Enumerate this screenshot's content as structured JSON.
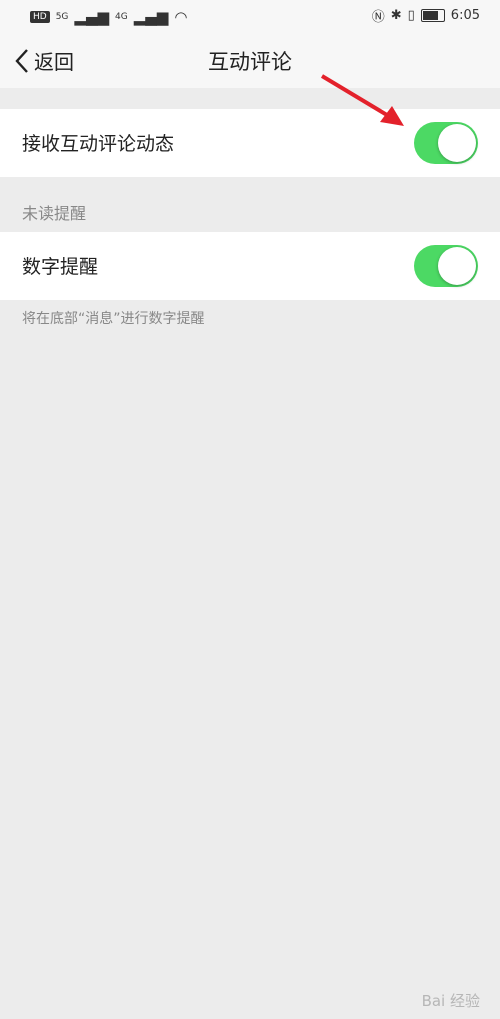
{
  "status_bar": {
    "hd_badge": "HD",
    "net1": "5G",
    "net2": "4G",
    "time": "6:05",
    "battery_level": 0.75
  },
  "nav": {
    "back_label": "返回",
    "title": "互动评论"
  },
  "settings": {
    "receive_comments": {
      "label": "接收互动评论动态",
      "enabled": true
    },
    "unread_section": "未读提醒",
    "number_reminder": {
      "label": "数字提醒",
      "enabled": true
    },
    "note": "将在底部“消息”进行数字提醒"
  },
  "colors": {
    "toggle_on": "#4cd964",
    "arrow": "#e3212b"
  },
  "watermark": "Bai 经验"
}
